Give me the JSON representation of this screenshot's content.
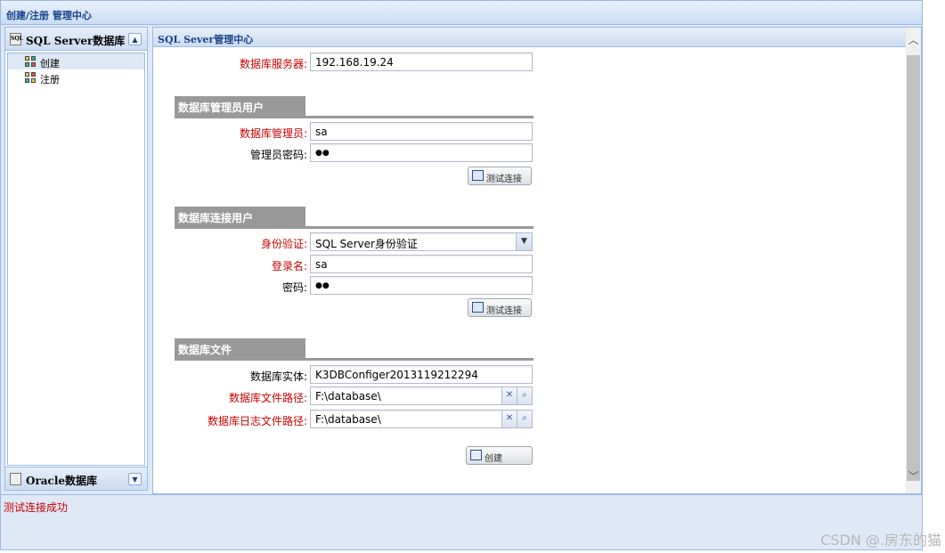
{
  "window": {
    "title": "创建/注册 管理中心"
  },
  "sidebar": {
    "panels": [
      {
        "title": "SQL Server数据库",
        "toggle": "▲",
        "items": [
          {
            "label": "创建",
            "selected": true
          },
          {
            "label": "注册",
            "selected": false
          }
        ]
      },
      {
        "title": "Oracle数据库",
        "toggle": "▼"
      }
    ]
  },
  "main": {
    "title": "SQL Sever管理中心",
    "server": {
      "label": "数据库服务器:",
      "value": "192.168.19.24"
    },
    "admin_section": {
      "title": "数据库管理员用户",
      "admin": {
        "label": "数据库管理员:",
        "value": "sa"
      },
      "password": {
        "label": "管理员密码:",
        "value": "●●"
      },
      "test_button": "测试连接"
    },
    "conn_section": {
      "title": "数据库连接用户",
      "auth": {
        "label": "身份验证:",
        "value": "SQL Server身份验证"
      },
      "login": {
        "label": "登录名:",
        "value": "sa"
      },
      "password": {
        "label": "密码:",
        "value": "●●"
      },
      "test_button": "测试连接"
    },
    "file_section": {
      "title": "数据库文件",
      "instance": {
        "label": "数据库实体:",
        "value": "K3DBConfiger2013119212294"
      },
      "data_path": {
        "label": "数据库文件路径:",
        "value": "F:\\database\\"
      },
      "log_path": {
        "label": "数据库日志文件路径:",
        "value": "F:\\database\\"
      }
    },
    "create_button": "创建"
  },
  "status": {
    "message": "测试连接成功"
  },
  "watermark": "CSDN @.房东的猫",
  "colors": {
    "required_label": "#cc0000",
    "panel_border": "#99bbe8",
    "header_text": "#15428b",
    "section_bg": "#999999"
  }
}
